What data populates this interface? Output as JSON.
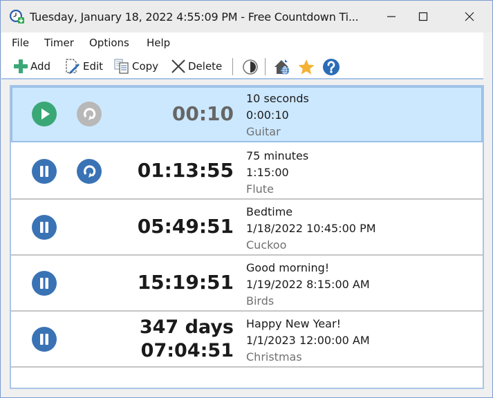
{
  "window": {
    "title": "Tuesday, January 18, 2022 4:55:09 PM - Free Countdown Ti...",
    "icon": "clock-download-icon",
    "controls": {
      "minimize": "minimize-icon",
      "maximize": "maximize-icon",
      "close": "close-icon"
    }
  },
  "menu": {
    "items": [
      {
        "label": "File"
      },
      {
        "label": "Timer"
      },
      {
        "label": "Options"
      },
      {
        "label": "Help"
      }
    ]
  },
  "toolbar": {
    "add_label": "Add",
    "edit_label": "Edit",
    "copy_label": "Copy",
    "delete_label": "Delete",
    "icons": [
      "plus-icon",
      "edit-icon",
      "copy-icon",
      "delete-x-icon",
      "contrast-icon",
      "home-web-icon",
      "star-icon",
      "help-icon"
    ]
  },
  "colors": {
    "selected_row": "#cce8ff",
    "play_green": "#3aa876",
    "pause_blue": "#3a73b5",
    "reset_disabled": "#b8b8b8",
    "star": "#f5b133",
    "help_blue": "#2b6cb8",
    "add_green": "#3aa876"
  },
  "timers": [
    {
      "state": "stopped",
      "primary_icon": "play-icon",
      "reset_icon": "reset-icon",
      "reset_enabled": false,
      "selected": true,
      "remaining_line1": "00:10",
      "remaining_line2": "",
      "name": "10 seconds",
      "target": "0:00:10",
      "sound": "Guitar"
    },
    {
      "state": "running",
      "primary_icon": "pause-icon",
      "reset_icon": "reset-icon",
      "reset_enabled": true,
      "selected": false,
      "remaining_line1": "01:13:55",
      "remaining_line2": "",
      "name": "75 minutes",
      "target": "1:15:00",
      "sound": "Flute"
    },
    {
      "state": "running",
      "primary_icon": "pause-icon",
      "selected": false,
      "remaining_line1": "05:49:51",
      "remaining_line2": "",
      "name": "Bedtime",
      "target": "1/18/2022 10:45:00 PM",
      "sound": "Cuckoo"
    },
    {
      "state": "running",
      "primary_icon": "pause-icon",
      "selected": false,
      "remaining_line1": "15:19:51",
      "remaining_line2": "",
      "name": "Good morning!",
      "target": "1/19/2022 8:15:00 AM",
      "sound": "Birds"
    },
    {
      "state": "running",
      "primary_icon": "pause-icon",
      "selected": false,
      "remaining_line1": "347 days",
      "remaining_line2": "07:04:51",
      "name": "Happy New Year!",
      "target": "1/1/2023 12:00:00 AM",
      "sound": "Christmas"
    }
  ]
}
